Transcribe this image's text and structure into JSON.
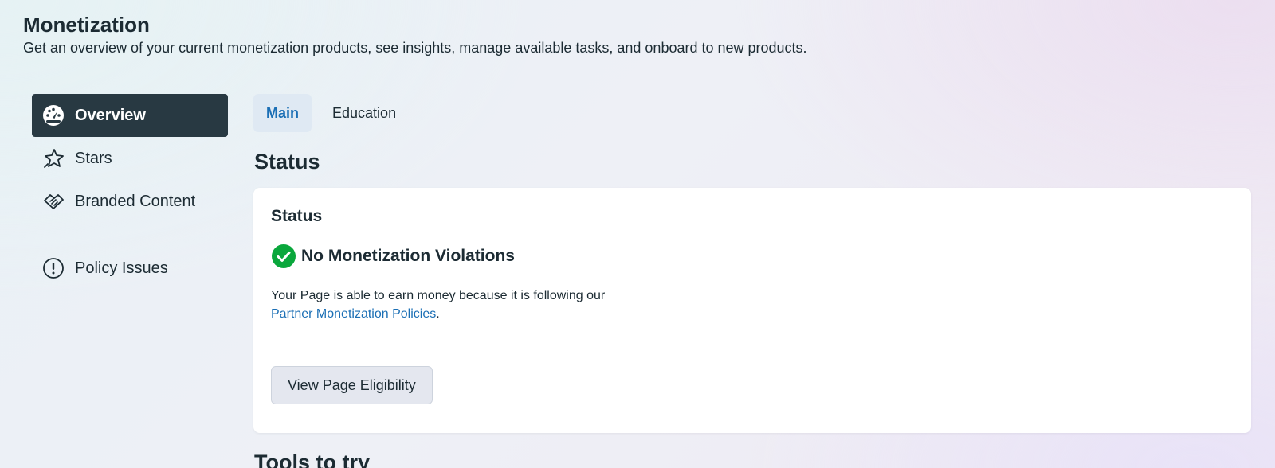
{
  "header": {
    "title": "Monetization",
    "subtitle": "Get an overview of your current monetization products, see insights, manage available tasks, and onboard to new products."
  },
  "sidebar": {
    "items": [
      {
        "label": "Overview",
        "icon": "dashboard-icon",
        "active": true
      },
      {
        "label": "Stars",
        "icon": "star-icon",
        "active": false
      },
      {
        "label": "Branded Content",
        "icon": "handshake-icon",
        "active": false
      },
      {
        "label": "Policy Issues",
        "icon": "exclamation-circle-icon",
        "active": false
      }
    ]
  },
  "tabs": [
    {
      "label": "Main",
      "active": true
    },
    {
      "label": "Education",
      "active": false
    }
  ],
  "main": {
    "section_heading": "Status",
    "status_card": {
      "title": "Status",
      "status_text": "No Monetization Violations",
      "status_icon": "check-circle-icon",
      "description_prefix": "Your Page is able to earn money because it is following our",
      "policy_link_text": "Partner Monetization Policies",
      "description_suffix": ".",
      "button_label": "View Page Eligibility"
    },
    "next_section_heading": "Tools to try"
  },
  "colors": {
    "active_sidebar_bg": "#283942",
    "active_tab_bg": "#dfe9f3",
    "link": "#1b6fb5",
    "success": "#0aa73c"
  }
}
